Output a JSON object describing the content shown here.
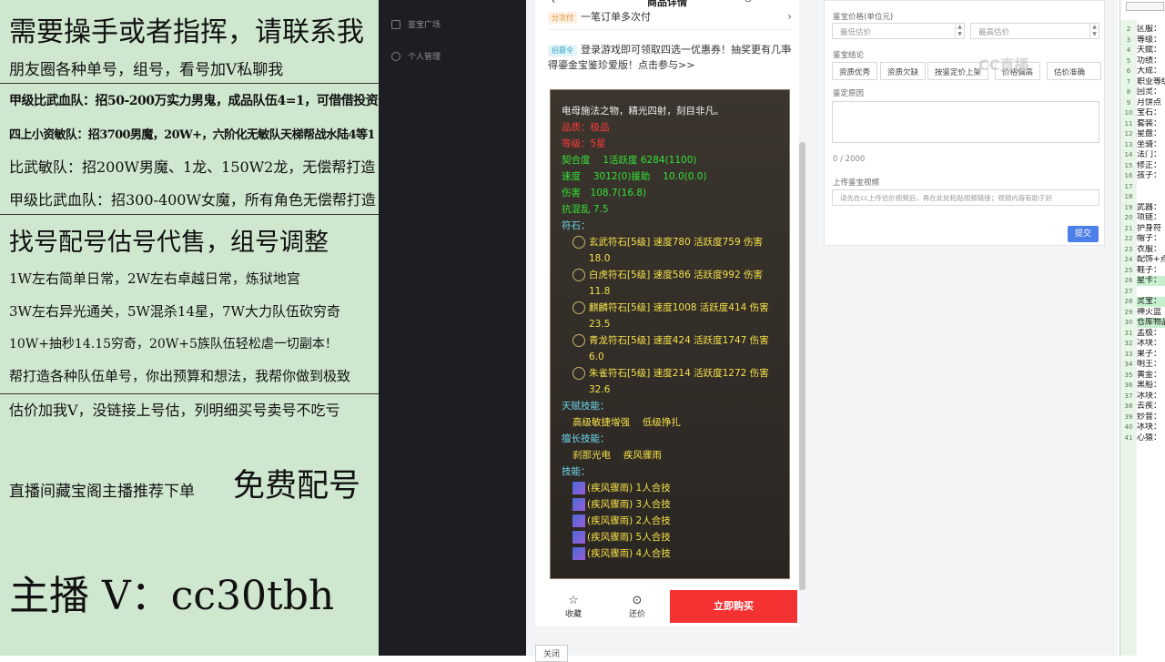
{
  "promo": {
    "lines": [
      "需要操手或者指挥，请联系我",
      "朋友圈各种单号，组号，看号加V私聊我",
      "甲级比武血队：招50-200万实力男鬼，成品队伍4=1，可借借投资",
      "四上小资敏队：招3700男魔，20W+，六阶化无敏队天梯帮战水陆4等1",
      "比武敏队：招200W男魔、1龙、150W2龙，无偿帮打造",
      "甲级比武血队：招300-400W女魔，所有角色无偿帮打造",
      "找号配号估号代售，组号调整",
      "1W左右简单日常，2W左右卓越日常，炼狱地宫",
      "3W左右异光通关，5W混杀14星，7W大力队伍砍穷奇",
      "10W+抽秒14.15穷奇，20W+5族队伍轻松虐一切副本！",
      "帮打造各种队伍单号，你出预算和想法，我帮你做到极致",
      "估价加我V，没链接上号估，列明细买号卖号不吃亏",
      "直播间藏宝阁主播推荐下单",
      "免费配号",
      "主播 V：cc30tbh"
    ]
  },
  "sidebar": {
    "items": [
      {
        "label": "鉴宝广场",
        "icon": "home-icon"
      },
      {
        "label": "个人管理",
        "icon": "user-icon"
      }
    ]
  },
  "detail": {
    "title": "商品详情",
    "promo1_tag": "分次付",
    "promo1_text": "一笔订单多次付",
    "promo2_tag": "招募令",
    "promo2_text": "登录游戏即可领取四选一优惠券！抽奖更有几率得鎏金宝鉴珍爱版！点击参与>>",
    "stats": {
      "intro": "电母施法之物，精光四射，刻目非凡。",
      "red1": "品质：极品",
      "red2": "等级：5星",
      "green1": "契合度　 1活跃度  6284(1100)",
      "green2": "速度　 3012(0)援助　 10.0(0.0)",
      "green3": "伤害　108.7(16.8)",
      "green4": "抗混乱 7.5",
      "rune_title": "符石：",
      "runes": [
        "玄武符石[5级] 速度780 活跃度759 伤害18.0",
        "白虎符石[5级] 速度586 活跃度992 伤害11.8",
        "麒麟符石[5级] 速度1008 活跃度414 伤害23.5",
        "青龙符石[5级] 速度424 活跃度1747 伤害6.0",
        "朱雀符石[5级] 速度214 活跃度1272 伤害32.6"
      ],
      "talent_title": "天赋技能：",
      "talent": "高级敏捷增强　 低级挣扎",
      "special_title": "擅长技能：",
      "special": "刹那光电　 疾风骤雨",
      "skill_title": "技能：",
      "skills": [
        "(疾风骤雨) 1人合技",
        "(疾风骤雨) 3人合技",
        "(疾风骤雨) 2人合技",
        "(疾风骤雨) 5人合技",
        "(疾风骤雨) 4人合技"
      ]
    },
    "fav_label": "收藏",
    "bargain_label": "还价",
    "buy_label": "立即购买",
    "close_label": "关闭"
  },
  "form": {
    "price_label": "鉴宝价格(单位元)",
    "min_placeholder": "最低估价",
    "max_placeholder": "最高估价",
    "conclusion_label": "鉴宝结论",
    "options": [
      "资质优秀",
      "资质欠缺",
      "按鉴定价上架",
      "价格偏高",
      "估价准确"
    ],
    "reason_label": "鉴定原因",
    "counter": "0 / 2000",
    "video_label": "上传鉴宝视频",
    "video_placeholder": "请先在cc上传估价视频后，再在此处粘贴视频链接；视频内容有助于好",
    "submit_label": "提交",
    "watermark": "CC直播"
  },
  "sheet": {
    "rows": [
      "区服：",
      "等级：",
      "天赋：",
      "功绩：",
      "大成：",
      "职业等级：",
      "回灵：",
      "月饼点",
      "宝石：",
      "套装：",
      "星盘：",
      "坐骑：",
      "法门：",
      "修正：",
      "孩子：",
      "",
      "",
      "武器：",
      "项链：",
      "护身符",
      "帽子：",
      "衣服：",
      "配饰+点",
      "鞋子：",
      "星卡：",
      "",
      "灵宝：",
      "神火蓝",
      "仓库物品",
      "孟极：",
      "冰块：",
      "果子：",
      "明王：",
      "黄金：",
      "黑船：",
      "冰块：",
      "去疾：",
      "妙音：",
      "冰块：",
      "心猿："
    ]
  }
}
